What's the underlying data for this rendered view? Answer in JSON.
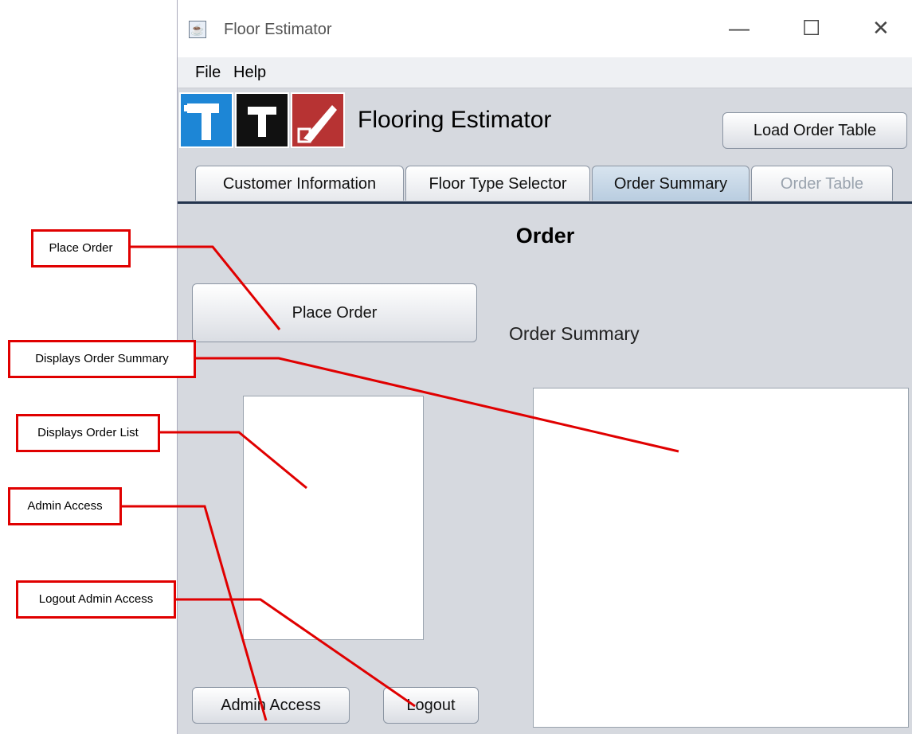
{
  "window": {
    "title": "Floor Estimator",
    "controls": {
      "minimize": "—",
      "maximize": "☐",
      "close": "✕"
    }
  },
  "menu": [
    "File",
    "Help"
  ],
  "header": {
    "title": "Flooring Estimator",
    "load_button": "Load Order Table"
  },
  "tabs": [
    {
      "label": "Customer Information",
      "state": "normal"
    },
    {
      "label": "Floor Type Selector",
      "state": "normal"
    },
    {
      "label": "Order Summary",
      "state": "active"
    },
    {
      "label": "Order Table",
      "state": "disabled"
    }
  ],
  "main": {
    "section_title": "Order",
    "place_order_button": "Place Order",
    "order_summary_label": "Order Summary",
    "admin_button": "Admin Access",
    "logout_button": "Logout"
  },
  "callouts": {
    "place_order": "Place Order",
    "displays_summary": "Displays Order Summary",
    "displays_list": "Displays Order List",
    "admin_access": "Admin Access",
    "logout_admin": "Logout Admin Access"
  },
  "colors": {
    "callout_red": "#e00000",
    "logo_blue": "#1d86d6",
    "logo_black": "#111111",
    "logo_red": "#b73333"
  }
}
